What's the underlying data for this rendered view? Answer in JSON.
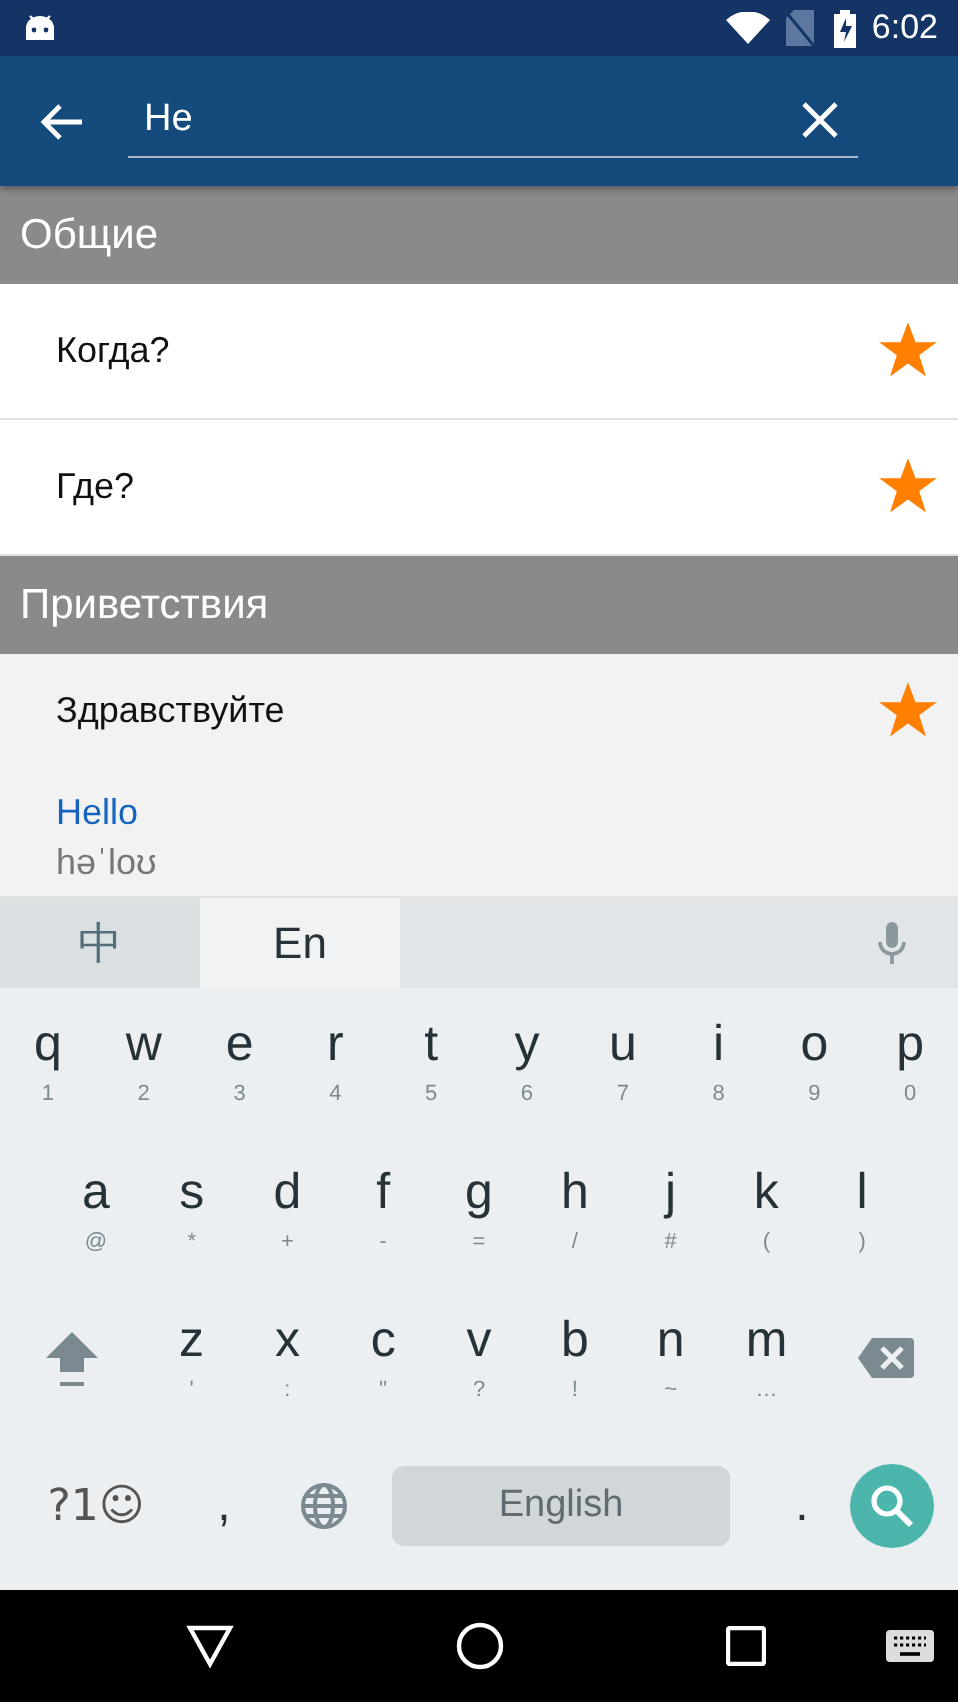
{
  "status_bar": {
    "time": "6:02"
  },
  "search": {
    "value": "He"
  },
  "sections": [
    {
      "title": "Общие",
      "items": [
        {
          "phrase": "Когда?",
          "starred": true,
          "expanded": false
        },
        {
          "phrase": "Где?",
          "starred": true,
          "expanded": false
        }
      ]
    },
    {
      "title": "Приветствия",
      "items": [
        {
          "phrase": "Здравствуйте",
          "starred": true,
          "expanded": true,
          "translation": "Hello",
          "transcription": "həˈloʊ"
        }
      ]
    }
  ],
  "keyboard": {
    "candidates": [
      {
        "label": "中",
        "selected": false
      },
      {
        "label": "En",
        "selected": true
      }
    ],
    "rows": [
      [
        {
          "kind": "letter",
          "label": "q",
          "hint": "1"
        },
        {
          "kind": "letter",
          "label": "w",
          "hint": "2"
        },
        {
          "kind": "letter",
          "label": "e",
          "hint": "3"
        },
        {
          "kind": "letter",
          "label": "r",
          "hint": "4"
        },
        {
          "kind": "letter",
          "label": "t",
          "hint": "5"
        },
        {
          "kind": "letter",
          "label": "y",
          "hint": "6"
        },
        {
          "kind": "letter",
          "label": "u",
          "hint": "7"
        },
        {
          "kind": "letter",
          "label": "i",
          "hint": "8"
        },
        {
          "kind": "letter",
          "label": "o",
          "hint": "9"
        },
        {
          "kind": "letter",
          "label": "p",
          "hint": "0"
        }
      ],
      [
        {
          "kind": "letter",
          "label": "a",
          "hint": "@"
        },
        {
          "kind": "letter",
          "label": "s",
          "hint": "*"
        },
        {
          "kind": "letter",
          "label": "d",
          "hint": "+"
        },
        {
          "kind": "letter",
          "label": "f",
          "hint": "-"
        },
        {
          "kind": "letter",
          "label": "g",
          "hint": "="
        },
        {
          "kind": "letter",
          "label": "h",
          "hint": "/"
        },
        {
          "kind": "letter",
          "label": "j",
          "hint": "#"
        },
        {
          "kind": "letter",
          "label": "k",
          "hint": "("
        },
        {
          "kind": "letter",
          "label": "l",
          "hint": ")"
        }
      ],
      [
        {
          "kind": "shift"
        },
        {
          "kind": "letter",
          "label": "z",
          "hint": "'"
        },
        {
          "kind": "letter",
          "label": "x",
          "hint": ":"
        },
        {
          "kind": "letter",
          "label": "c",
          "hint": "\""
        },
        {
          "kind": "letter",
          "label": "v",
          "hint": "?"
        },
        {
          "kind": "letter",
          "label": "b",
          "hint": "!"
        },
        {
          "kind": "letter",
          "label": "n",
          "hint": "~"
        },
        {
          "kind": "letter",
          "label": "m",
          "hint": "…"
        },
        {
          "kind": "backspace"
        }
      ]
    ],
    "symbols_key": "?1☺",
    "comma_key": ",",
    "space_key": "English",
    "period_key": "."
  }
}
